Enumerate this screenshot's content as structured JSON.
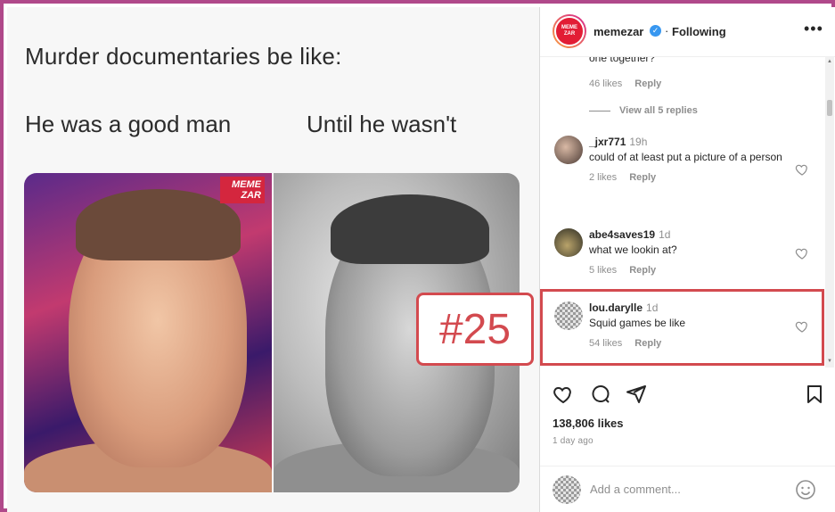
{
  "meme": {
    "caption": "Murder documentaries be like:",
    "left_label": "He was a good man",
    "right_label": "Until he wasn't",
    "watermark": "MEME ZAR",
    "rank": "#25"
  },
  "post": {
    "username": "memezar",
    "follow_state": "Following",
    "brand_avatar_text": "MEME ZAR",
    "more_label": "•••"
  },
  "comments": {
    "clipped_text": "one together?",
    "clipped_meta": {
      "likes": "46 likes",
      "reply": "Reply"
    },
    "view_replies": "View all 5 replies",
    "items": [
      {
        "user": "_jxr771",
        "time": "19h",
        "text": "could of at least put a picture of a person",
        "likes": "2 likes",
        "reply": "Reply"
      },
      {
        "user": "abe4saves19",
        "time": "1d",
        "text": "what we lookin at?",
        "likes": "5 likes",
        "reply": "Reply"
      },
      {
        "user": "lou.darylle",
        "time": "1d",
        "text": "Squid games be like",
        "likes": "54 likes",
        "reply": "Reply"
      }
    ]
  },
  "footer": {
    "likes": "138,806 likes",
    "date": "1 day ago",
    "add_comment_placeholder": "Add a comment..."
  },
  "colors": {
    "frame": "#b0498a",
    "highlight": "#d34a4f",
    "verified": "#3897f0"
  },
  "icons": [
    "verified-icon",
    "more-icon",
    "heart-icon",
    "comment-icon",
    "share-icon",
    "bookmark-icon",
    "emoji-icon"
  ]
}
